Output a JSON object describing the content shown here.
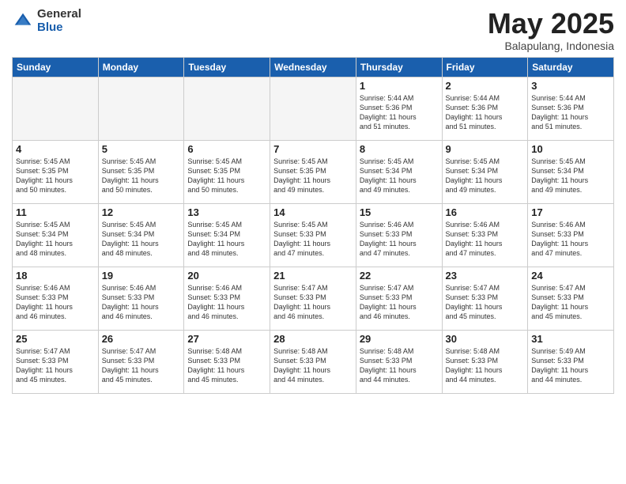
{
  "logo": {
    "general": "General",
    "blue": "Blue"
  },
  "title": {
    "month_year": "May 2025",
    "location": "Balapulang, Indonesia"
  },
  "days_of_week": [
    "Sunday",
    "Monday",
    "Tuesday",
    "Wednesday",
    "Thursday",
    "Friday",
    "Saturday"
  ],
  "weeks": [
    [
      {
        "day": "",
        "info": ""
      },
      {
        "day": "",
        "info": ""
      },
      {
        "day": "",
        "info": ""
      },
      {
        "day": "",
        "info": ""
      },
      {
        "day": "1",
        "info": "Sunrise: 5:44 AM\nSunset: 5:36 PM\nDaylight: 11 hours\nand 51 minutes."
      },
      {
        "day": "2",
        "info": "Sunrise: 5:44 AM\nSunset: 5:36 PM\nDaylight: 11 hours\nand 51 minutes."
      },
      {
        "day": "3",
        "info": "Sunrise: 5:44 AM\nSunset: 5:36 PM\nDaylight: 11 hours\nand 51 minutes."
      }
    ],
    [
      {
        "day": "4",
        "info": "Sunrise: 5:45 AM\nSunset: 5:35 PM\nDaylight: 11 hours\nand 50 minutes."
      },
      {
        "day": "5",
        "info": "Sunrise: 5:45 AM\nSunset: 5:35 PM\nDaylight: 11 hours\nand 50 minutes."
      },
      {
        "day": "6",
        "info": "Sunrise: 5:45 AM\nSunset: 5:35 PM\nDaylight: 11 hours\nand 50 minutes."
      },
      {
        "day": "7",
        "info": "Sunrise: 5:45 AM\nSunset: 5:35 PM\nDaylight: 11 hours\nand 49 minutes."
      },
      {
        "day": "8",
        "info": "Sunrise: 5:45 AM\nSunset: 5:34 PM\nDaylight: 11 hours\nand 49 minutes."
      },
      {
        "day": "9",
        "info": "Sunrise: 5:45 AM\nSunset: 5:34 PM\nDaylight: 11 hours\nand 49 minutes."
      },
      {
        "day": "10",
        "info": "Sunrise: 5:45 AM\nSunset: 5:34 PM\nDaylight: 11 hours\nand 49 minutes."
      }
    ],
    [
      {
        "day": "11",
        "info": "Sunrise: 5:45 AM\nSunset: 5:34 PM\nDaylight: 11 hours\nand 48 minutes."
      },
      {
        "day": "12",
        "info": "Sunrise: 5:45 AM\nSunset: 5:34 PM\nDaylight: 11 hours\nand 48 minutes."
      },
      {
        "day": "13",
        "info": "Sunrise: 5:45 AM\nSunset: 5:34 PM\nDaylight: 11 hours\nand 48 minutes."
      },
      {
        "day": "14",
        "info": "Sunrise: 5:45 AM\nSunset: 5:33 PM\nDaylight: 11 hours\nand 47 minutes."
      },
      {
        "day": "15",
        "info": "Sunrise: 5:46 AM\nSunset: 5:33 PM\nDaylight: 11 hours\nand 47 minutes."
      },
      {
        "day": "16",
        "info": "Sunrise: 5:46 AM\nSunset: 5:33 PM\nDaylight: 11 hours\nand 47 minutes."
      },
      {
        "day": "17",
        "info": "Sunrise: 5:46 AM\nSunset: 5:33 PM\nDaylight: 11 hours\nand 47 minutes."
      }
    ],
    [
      {
        "day": "18",
        "info": "Sunrise: 5:46 AM\nSunset: 5:33 PM\nDaylight: 11 hours\nand 46 minutes."
      },
      {
        "day": "19",
        "info": "Sunrise: 5:46 AM\nSunset: 5:33 PM\nDaylight: 11 hours\nand 46 minutes."
      },
      {
        "day": "20",
        "info": "Sunrise: 5:46 AM\nSunset: 5:33 PM\nDaylight: 11 hours\nand 46 minutes."
      },
      {
        "day": "21",
        "info": "Sunrise: 5:47 AM\nSunset: 5:33 PM\nDaylight: 11 hours\nand 46 minutes."
      },
      {
        "day": "22",
        "info": "Sunrise: 5:47 AM\nSunset: 5:33 PM\nDaylight: 11 hours\nand 46 minutes."
      },
      {
        "day": "23",
        "info": "Sunrise: 5:47 AM\nSunset: 5:33 PM\nDaylight: 11 hours\nand 45 minutes."
      },
      {
        "day": "24",
        "info": "Sunrise: 5:47 AM\nSunset: 5:33 PM\nDaylight: 11 hours\nand 45 minutes."
      }
    ],
    [
      {
        "day": "25",
        "info": "Sunrise: 5:47 AM\nSunset: 5:33 PM\nDaylight: 11 hours\nand 45 minutes."
      },
      {
        "day": "26",
        "info": "Sunrise: 5:47 AM\nSunset: 5:33 PM\nDaylight: 11 hours\nand 45 minutes."
      },
      {
        "day": "27",
        "info": "Sunrise: 5:48 AM\nSunset: 5:33 PM\nDaylight: 11 hours\nand 45 minutes."
      },
      {
        "day": "28",
        "info": "Sunrise: 5:48 AM\nSunset: 5:33 PM\nDaylight: 11 hours\nand 44 minutes."
      },
      {
        "day": "29",
        "info": "Sunrise: 5:48 AM\nSunset: 5:33 PM\nDaylight: 11 hours\nand 44 minutes."
      },
      {
        "day": "30",
        "info": "Sunrise: 5:48 AM\nSunset: 5:33 PM\nDaylight: 11 hours\nand 44 minutes."
      },
      {
        "day": "31",
        "info": "Sunrise: 5:49 AM\nSunset: 5:33 PM\nDaylight: 11 hours\nand 44 minutes."
      }
    ]
  ]
}
